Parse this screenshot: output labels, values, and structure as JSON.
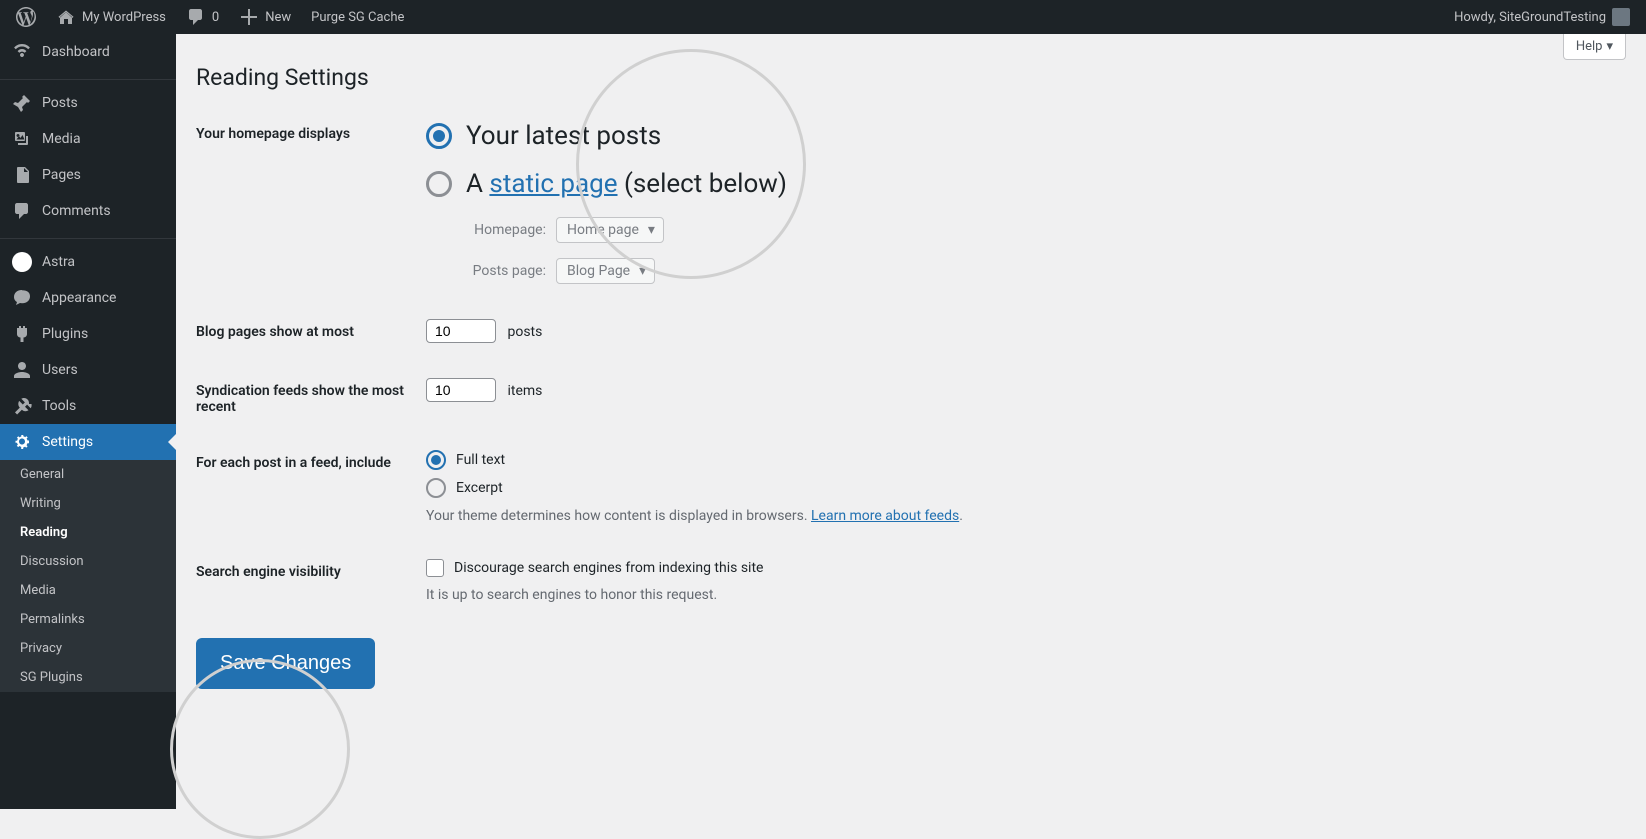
{
  "adminBar": {
    "siteName": "My WordPress",
    "commentCount": "0",
    "newLabel": "New",
    "purgeLabel": "Purge SG Cache",
    "howdy": "Howdy, SiteGroundTesting"
  },
  "sidebar": {
    "items": [
      {
        "label": "Dashboard"
      },
      {
        "label": "Posts"
      },
      {
        "label": "Media"
      },
      {
        "label": "Pages"
      },
      {
        "label": "Comments"
      },
      {
        "label": "Astra"
      },
      {
        "label": "Appearance"
      },
      {
        "label": "Plugins"
      },
      {
        "label": "Users"
      },
      {
        "label": "Tools"
      },
      {
        "label": "Settings"
      }
    ],
    "submenu": [
      {
        "label": "General"
      },
      {
        "label": "Writing"
      },
      {
        "label": "Reading"
      },
      {
        "label": "Discussion"
      },
      {
        "label": "Media"
      },
      {
        "label": "Permalinks"
      },
      {
        "label": "Privacy"
      },
      {
        "label": "SG Plugins"
      }
    ]
  },
  "page": {
    "helpLabel": "Help",
    "title": "Reading Settings",
    "homepageLabel": "Your homepage displays",
    "latestPostsLabel": "Your latest posts",
    "staticPagePrefix": "A ",
    "staticPageLink": "static page",
    "staticPageSuffix": " (select below)",
    "homepageSelectLabel": "Homepage:",
    "homepageSelectValue": "Home page",
    "postsPageLabel": "Posts page:",
    "postsPageValue": "Blog Page",
    "blogPagesLabel": "Blog pages show at most",
    "blogPagesValue": "10",
    "postsSuffix": "posts",
    "syndicationLabel": "Syndication feeds show the most recent",
    "syndicationValue": "10",
    "itemsSuffix": "items",
    "feedIncludeLabel": "For each post in a feed, include",
    "fullTextLabel": "Full text",
    "excerptLabel": "Excerpt",
    "feedDescriptionPrefix": "Your theme determines how content is displayed in browsers. ",
    "feedDescriptionLink": "Learn more about feeds",
    "feedDescriptionSuffix": ".",
    "searchVisibilityLabel": "Search engine visibility",
    "discourageLabel": "Discourage search engines from indexing this site",
    "searchNote": "It is up to search engines to honor this request.",
    "saveButton": "Save Changes"
  }
}
